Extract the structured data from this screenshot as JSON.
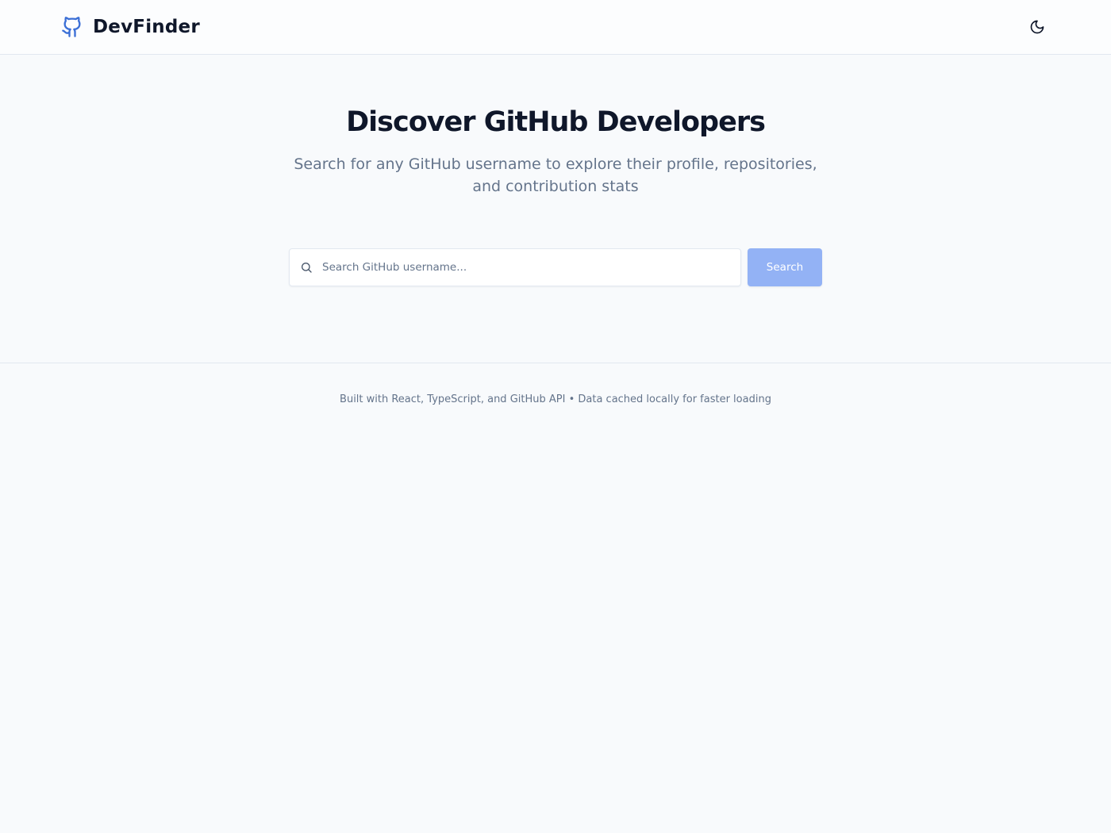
{
  "header": {
    "app_name": "DevFinder",
    "logo_icon": "github-icon",
    "theme_toggle_icon": "moon-icon"
  },
  "hero": {
    "title": "Discover GitHub Developers",
    "subtitle": "Search for any GitHub username to explore their profile, repositories, and contribution stats"
  },
  "search": {
    "placeholder": "Search GitHub username...",
    "value": "",
    "icon": "search-icon",
    "button_label": "Search"
  },
  "footer": {
    "text": "Built with React, TypeScript, and GitHub API • Data cached locally for faster loading"
  },
  "colors": {
    "accent": "#3b6fd6",
    "button_disabled": "#93b2f5",
    "background": "#f8fafc",
    "muted_text": "#64748b"
  }
}
